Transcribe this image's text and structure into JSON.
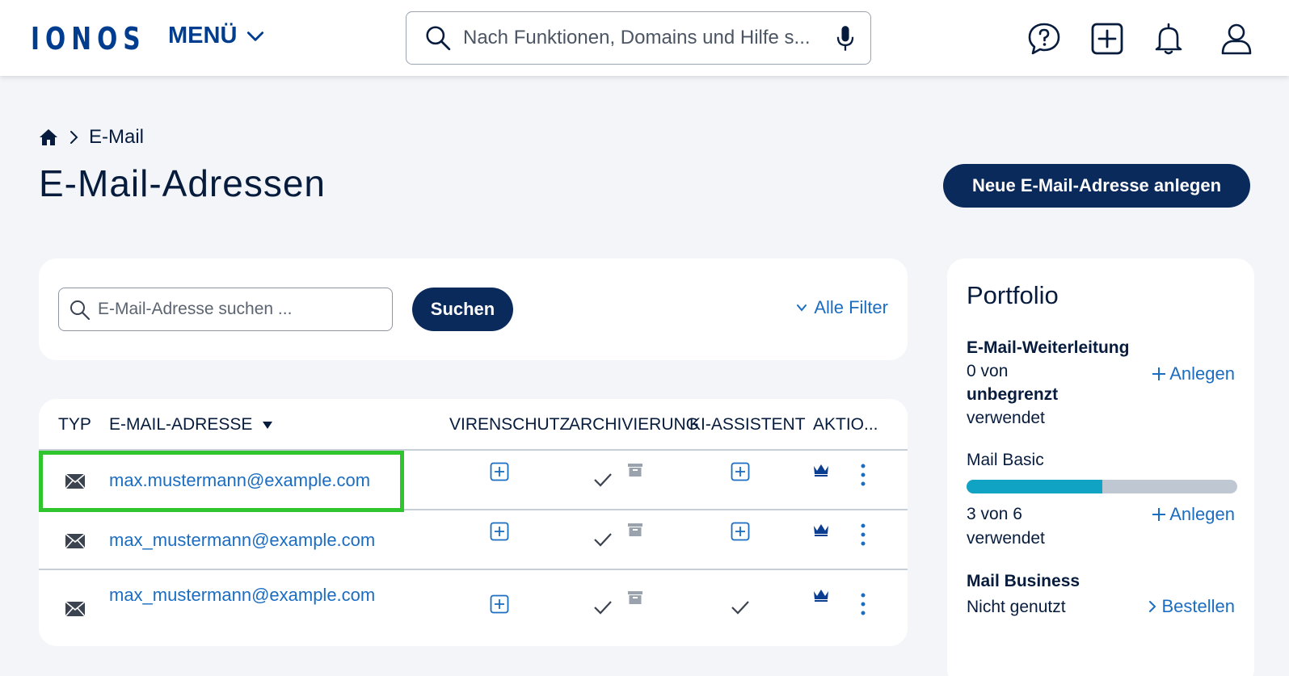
{
  "header": {
    "logo": "IONOS",
    "menu_label": "MENÜ",
    "search_placeholder": "Nach Funktionen, Domains und Hilfe s..."
  },
  "breadcrumb": {
    "current": "E-Mail"
  },
  "page": {
    "title": "E-Mail-Adressen",
    "new_button": "Neue E-Mail-Adresse anlegen"
  },
  "search": {
    "placeholder": "E-Mail-Adresse suchen ...",
    "button": "Suchen",
    "filter_label": "Alle Filter"
  },
  "table": {
    "columns": {
      "typ": "TYP",
      "email": "E-MAIL-ADRESSE",
      "virenschutz": "VIRENSCHUTZ",
      "archivierung": "ARCHIVIERUNG",
      "ki": "KI-ASSISTENT",
      "aktionen": "AKTIO..."
    },
    "rows": [
      {
        "email": "max.mustermann@example.com",
        "virenschutz": "add",
        "archivierung": "active",
        "ki": "add"
      },
      {
        "email": "max_mustermann@example.com",
        "virenschutz": "add",
        "archivierung": "active",
        "ki": "add"
      },
      {
        "email": "max_mustermann@example.com",
        "virenschutz": "add",
        "archivierung": "active",
        "ki": "active"
      }
    ]
  },
  "portfolio": {
    "title": "Portfolio",
    "weiterleitung": {
      "title": "E-Mail-Weiterleitung",
      "used_prefix": "0 von",
      "used_strong": "unbegrenzt",
      "used_suffix": "verwendet",
      "link": "Anlegen"
    },
    "basic": {
      "title": "Mail Basic",
      "used": "3 von 6",
      "used_suffix": "verwendet",
      "usage_fraction": 0.5,
      "link": "Anlegen"
    },
    "business": {
      "title": "Mail Business",
      "status": "Nicht genutzt",
      "link": "Bestellen"
    }
  },
  "colors": {
    "brand_blue": "#003d8f",
    "navy": "#0b2a5c",
    "link": "#1b6dc1",
    "highlight": "#2ec52e",
    "bar_fill": "#11a3c4"
  }
}
